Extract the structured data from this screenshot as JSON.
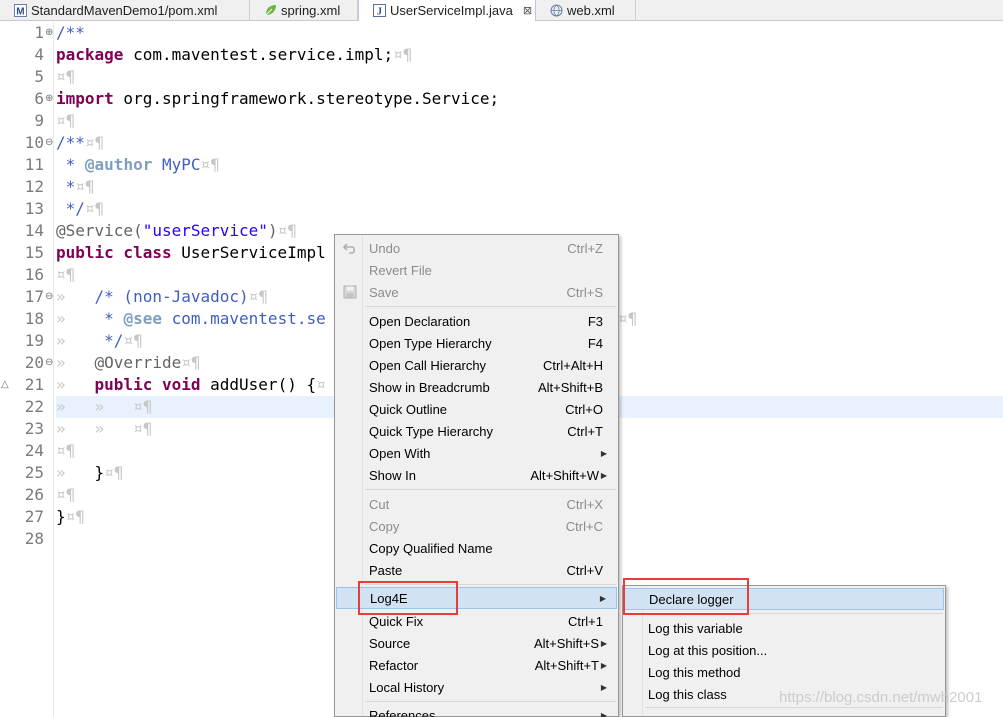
{
  "tabs": [
    {
      "label": "StandardMavenDemo1/pom.xml",
      "icon": "maven-pom-icon",
      "active": false
    },
    {
      "label": "spring.xml",
      "icon": "spring-leaf-icon",
      "active": false
    },
    {
      "label": "UserServiceImpl.java",
      "icon": "java-file-icon",
      "active": true,
      "close": "⊠"
    },
    {
      "label": "web.xml",
      "icon": "xml-file-icon",
      "active": false
    }
  ],
  "editor": {
    "line_numbers": [
      "1",
      "4",
      "5",
      "6",
      "9",
      "10",
      "11",
      "12",
      "13",
      "14",
      "15",
      "16",
      "17",
      "18",
      "19",
      "20",
      "21",
      "22",
      "23",
      "24",
      "25",
      "26",
      "27",
      "28"
    ],
    "lines": {
      "l1": {
        "a": "/**"
      },
      "l4": {
        "a": "package",
        "b": " com.maventest.service.impl;",
        "c": "¤¶"
      },
      "l5": {
        "c": "¤¶"
      },
      "l6": {
        "a": "import",
        "b": " org.springframework.stereotype.Service;"
      },
      "l9": {
        "c": "¤¶"
      },
      "l10": {
        "a": "/**",
        "c": "¤¶"
      },
      "l11": {
        "a": " * ",
        "t": "@author",
        "b": " MyPC",
        "c": "¤¶"
      },
      "l12": {
        "a": " *",
        "c": "¤¶"
      },
      "l13": {
        "a": " */",
        "c": "¤¶"
      },
      "l14": {
        "a": "@Service(",
        "s": "\"userService\"",
        "b": ")",
        "c": "¤¶"
      },
      "l15": {
        "a": "public",
        "k2": " class",
        "b": " UserServiceImpl"
      },
      "l16": {
        "c": "¤¶"
      },
      "l17": {
        "w": "»   ",
        "a": "/* (non-Javadoc)",
        "c": "¤¶"
      },
      "l18": {
        "w": "»   ",
        "a": " * ",
        "t": "@see",
        "b": " com.maventest.se",
        "c2": "¤¶"
      },
      "l19": {
        "w": "»   ",
        "a": " */",
        "c": "¤¶"
      },
      "l20": {
        "w": "»   ",
        "a": "@Override",
        "c": "¤¶"
      },
      "l21": {
        "w": "»   ",
        "a": "public",
        "k2": " void",
        "b": " addUser() {",
        "c": "¤"
      },
      "l22": {
        "w": "»   »   ",
        "c": "¤¶"
      },
      "l23": {
        "w": "»   »   ",
        "c": "¤¶"
      },
      "l24": {
        "c": "¤¶"
      },
      "l25": {
        "w": "»   ",
        "b": "}",
        "c": "¤¶"
      },
      "l26": {
        "c": "¤¶"
      },
      "l27": {
        "b": "}",
        "c": "¤¶"
      }
    }
  },
  "context_menu": {
    "items": [
      {
        "label": "Undo",
        "accel": "Ctrl+Z",
        "disabled": true,
        "icon": "undo-icon"
      },
      {
        "label": "Revert File",
        "accel": "",
        "disabled": true
      },
      {
        "label": "Save",
        "accel": "Ctrl+S",
        "disabled": true,
        "icon": "save-icon"
      },
      {
        "label": "Open Declaration",
        "accel": "F3"
      },
      {
        "label": "Open Type Hierarchy",
        "accel": "F4"
      },
      {
        "label": "Open Call Hierarchy",
        "accel": "Ctrl+Alt+H"
      },
      {
        "label": "Show in Breadcrumb",
        "accel": "Alt+Shift+B"
      },
      {
        "label": "Quick Outline",
        "accel": "Ctrl+O"
      },
      {
        "label": "Quick Type Hierarchy",
        "accel": "Ctrl+T"
      },
      {
        "label": "Open With",
        "accel": "",
        "submenu": true
      },
      {
        "label": "Show In",
        "accel": "Alt+Shift+W",
        "submenu": true
      },
      {
        "label": "Cut",
        "accel": "Ctrl+X",
        "disabled": true
      },
      {
        "label": "Copy",
        "accel": "Ctrl+C",
        "disabled": true
      },
      {
        "label": "Copy Qualified Name",
        "accel": ""
      },
      {
        "label": "Paste",
        "accel": "Ctrl+V"
      },
      {
        "label": "Log4E",
        "accel": "",
        "submenu": true,
        "hover": true
      },
      {
        "label": "Quick Fix",
        "accel": "Ctrl+1"
      },
      {
        "label": "Source",
        "accel": "Alt+Shift+S",
        "submenu": true
      },
      {
        "label": "Refactor",
        "accel": "Alt+Shift+T",
        "submenu": true
      },
      {
        "label": "Local History",
        "accel": "",
        "submenu": true
      },
      {
        "label": "References",
        "accel": "",
        "submenu": true
      }
    ],
    "submenu_arrow": "▶"
  },
  "log4e_submenu": {
    "items": [
      {
        "label": "Declare logger",
        "hover": true
      },
      {
        "label": "Log this variable"
      },
      {
        "label": "Log at this position..."
      },
      {
        "label": "Log this method"
      },
      {
        "label": "Log this class"
      }
    ]
  },
  "watermark": "https://blog.csdn.net/mwb2001",
  "colors": {
    "keyword": "#7f0055",
    "comment": "#3f5fbf",
    "string": "#2a00ff",
    "menu_hover": "#d1e2f2",
    "highlight_box": "#e53e3e",
    "change_bar": "#8fc6c6"
  }
}
